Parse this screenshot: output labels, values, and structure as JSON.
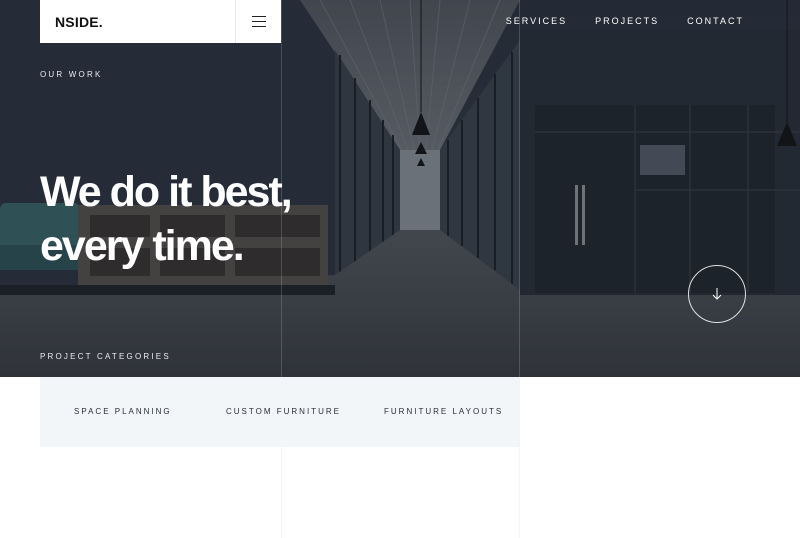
{
  "brand": {
    "logo": "NSIDE."
  },
  "nav": {
    "items": [
      "SERVICES",
      "PROJECTS",
      "CONTACT"
    ]
  },
  "hero": {
    "eyebrow": "OUR WORK",
    "headline_line1": "We do it best,",
    "headline_line2": "every time.",
    "categories_label": "PROJECT CATEGORIES"
  },
  "categories": [
    "SPACE PLANNING",
    "CUSTOM FURNITURE",
    "FURNITURE LAYOUTS"
  ],
  "icons": {
    "menu": "hamburger-menu-icon",
    "scroll": "arrow-down-icon"
  },
  "colors": {
    "text_light": "#ffffff",
    "panel_bg": "#f3f6f9",
    "dark_text": "#2a2f36"
  }
}
